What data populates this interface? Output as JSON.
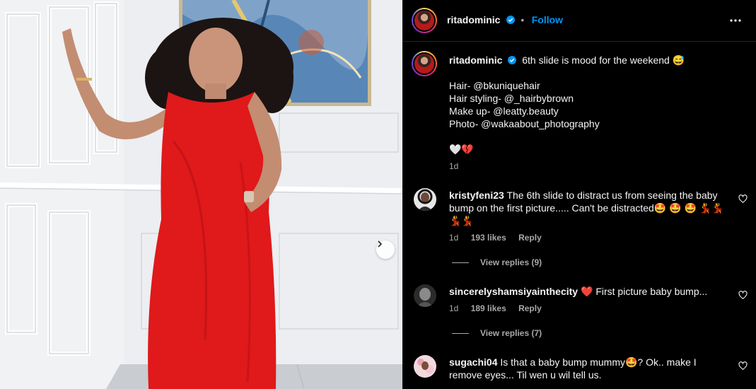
{
  "post": {
    "username": "ritadominic",
    "follow_label": "Follow",
    "dot": "•",
    "caption_lines": [
      "6th slide is mood for the weekend 😅",
      "",
      "Hair- @bkuniquehair",
      "Hair styling- @_hairbybrown",
      "Make up- @leatty.beauty",
      "Photo- @wakaabout_photography",
      "",
      "🤍💔"
    ],
    "caption_time": "1d"
  },
  "comments": [
    {
      "username": "kristyfeni23",
      "text_line1": "The 6th slide to distract us from seeing the baby",
      "text_line2": "bump on the first picture..... Can't be distracted🤩 🤩 🤩 💃💃",
      "text_line3": "💃💃",
      "time": "1d",
      "likes": "193 likes",
      "reply": "Reply",
      "view_replies": "View replies (9)"
    },
    {
      "username": "sincerelyshamsiyainthecity",
      "text_line1": "❤️  First picture baby bump...",
      "time": "1d",
      "likes": "189 likes",
      "reply": "Reply",
      "view_replies": "View replies (7)"
    },
    {
      "username": "sugachi04",
      "text_line1": "Is that a baby bump mummy🤩? Ok.. make I",
      "text_line2": "remove eyes... Til wen u wil tell us."
    }
  ],
  "icons": {
    "verified": "verified-badge-icon",
    "more": "more-options-icon",
    "next": "chevron-right-icon",
    "like": "heart-outline-icon"
  },
  "colors": {
    "accent": "#0095f6",
    "dress": "#e0191b",
    "background": "#000000"
  }
}
